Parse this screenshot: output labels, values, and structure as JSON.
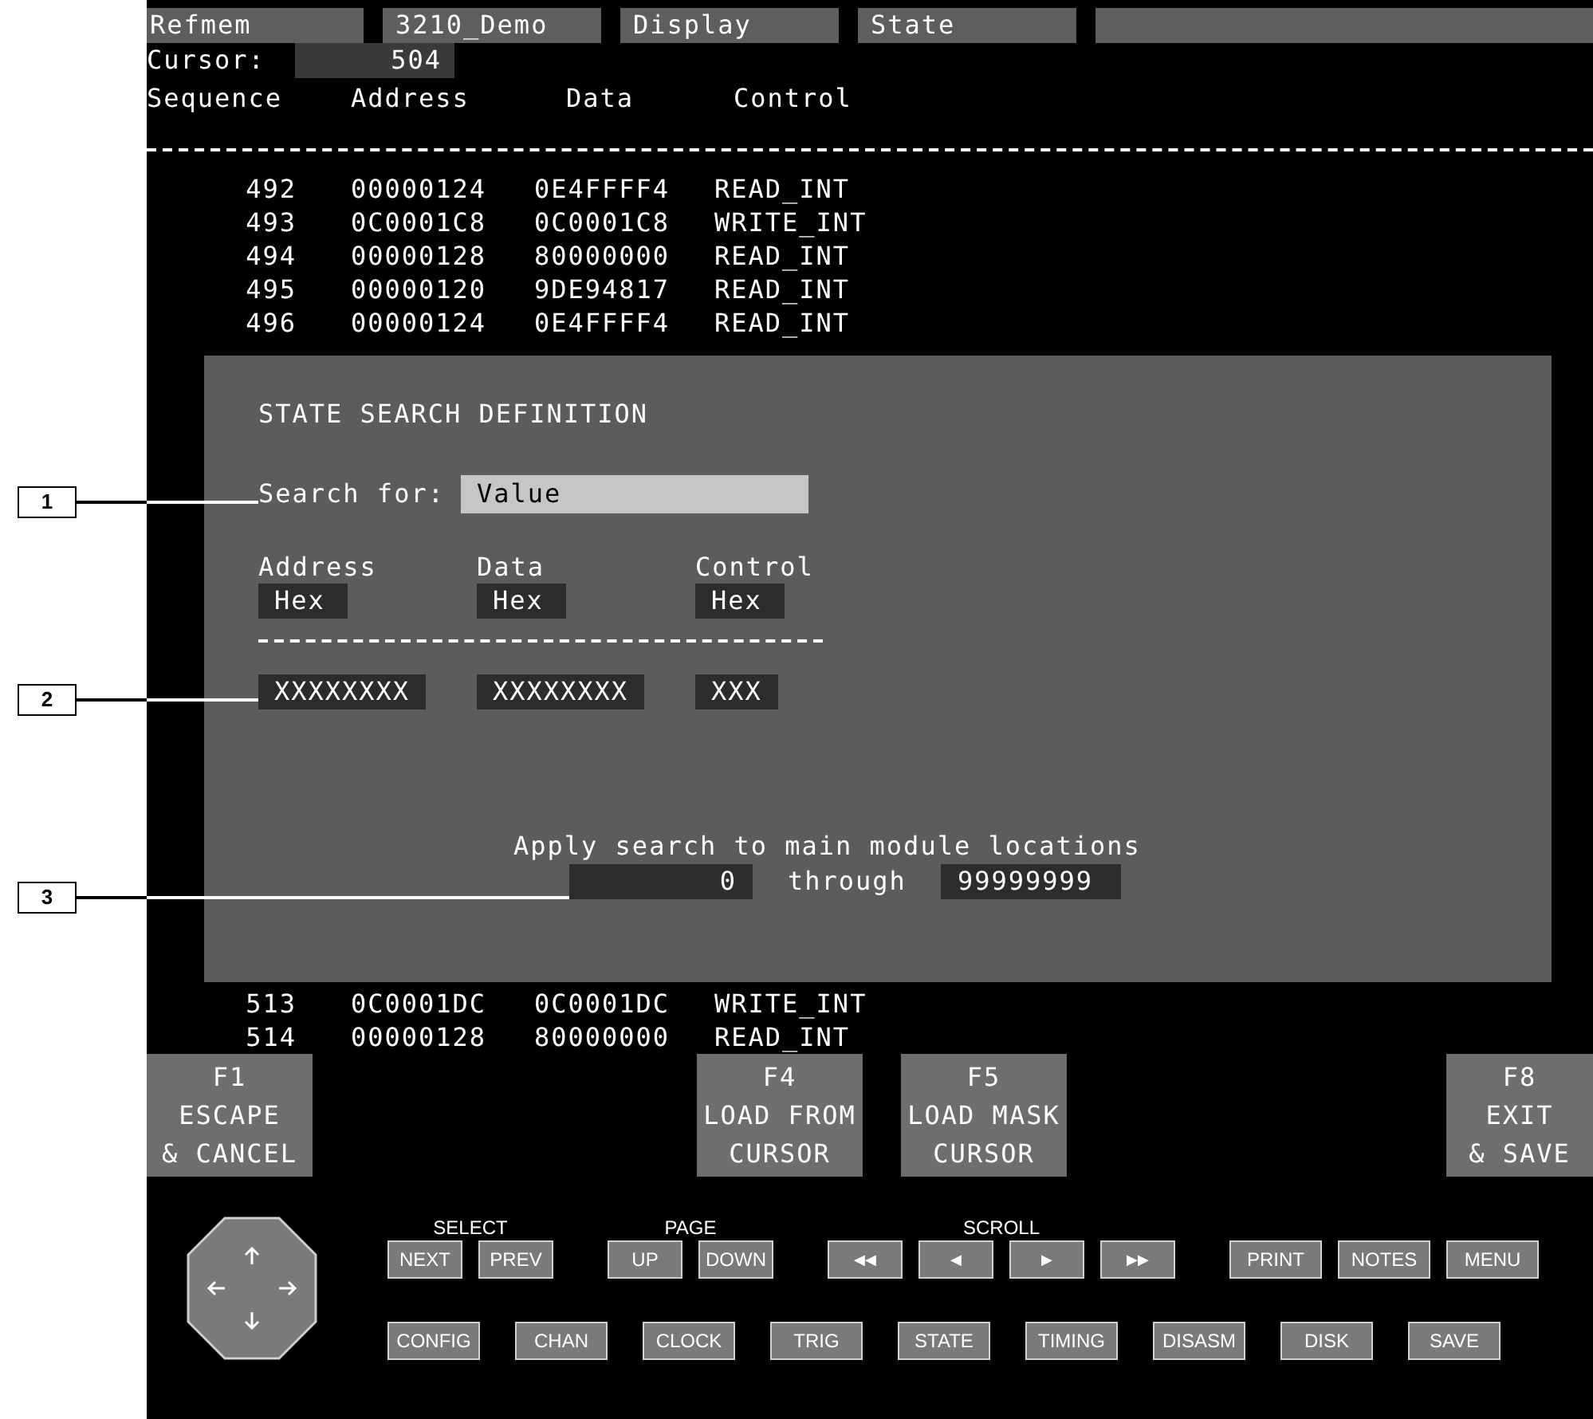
{
  "header_tabs": [
    "Refmem",
    "3210_Demo",
    "Display",
    "State"
  ],
  "cursor": {
    "label": "Cursor:",
    "value": "504"
  },
  "listing": {
    "columns": [
      "Sequence",
      "Address",
      "Data",
      "Control"
    ],
    "rows_top": [
      {
        "sequence": "492",
        "address": "00000124",
        "data": "0E4FFFF4",
        "control": "READ_INT"
      },
      {
        "sequence": "493",
        "address": "0C0001C8",
        "data": "0C0001C8",
        "control": "WRITE_INT"
      },
      {
        "sequence": "494",
        "address": "00000128",
        "data": "80000000",
        "control": "READ_INT"
      },
      {
        "sequence": "495",
        "address": "00000120",
        "data": "9DE94817",
        "control": "READ_INT"
      },
      {
        "sequence": "496",
        "address": "00000124",
        "data": "0E4FFFF4",
        "control": "READ_INT"
      }
    ],
    "rows_bottom": [
      {
        "sequence": "513",
        "address": "0C0001DC",
        "data": "0C0001DC",
        "control": "WRITE_INT"
      },
      {
        "sequence": "514",
        "address": "00000128",
        "data": "80000000",
        "control": "READ_INT"
      }
    ]
  },
  "search_dialog": {
    "title": "STATE SEARCH DEFINITION",
    "search_for": {
      "label": "Search for:",
      "value": "Value"
    },
    "fields": [
      {
        "name": "Address",
        "radix": "Hex",
        "value": "XXXXXXXX"
      },
      {
        "name": "Data",
        "radix": "Hex",
        "value": "XXXXXXXX"
      },
      {
        "name": "Control",
        "radix": "Hex",
        "value": "XXX"
      }
    ],
    "range": {
      "caption": "Apply search to main module locations",
      "start": "0",
      "joiner": "through",
      "end": "99999999"
    }
  },
  "function_keys": {
    "left": [
      {
        "key": "F1",
        "lines": [
          "ESCAPE",
          "& CANCEL"
        ]
      }
    ],
    "middle": [
      {
        "key": "F4",
        "lines": [
          "LOAD FROM",
          "CURSOR"
        ]
      },
      {
        "key": "F5",
        "lines": [
          "LOAD MASK",
          "CURSOR"
        ]
      }
    ],
    "right": [
      {
        "key": "F8",
        "lines": [
          "EXIT",
          "& SAVE"
        ]
      }
    ]
  },
  "nav_groups": [
    {
      "label": "SELECT",
      "buttons": [
        "NEXT",
        "PREV"
      ]
    },
    {
      "label": "PAGE",
      "buttons": [
        "UP",
        "DOWN"
      ]
    },
    {
      "label": "SCROLL",
      "buttons": [
        "◀◀",
        "◀",
        "▶",
        "▶▶"
      ]
    }
  ],
  "utility_buttons": [
    "PRINT",
    "NOTES",
    "MENU"
  ],
  "mode_buttons": [
    "CONFIG",
    "CHAN",
    "CLOCK",
    "TRIG",
    "STATE",
    "TIMING",
    "DISASM",
    "DISK",
    "SAVE"
  ],
  "callouts": [
    "1",
    "2",
    "3"
  ]
}
